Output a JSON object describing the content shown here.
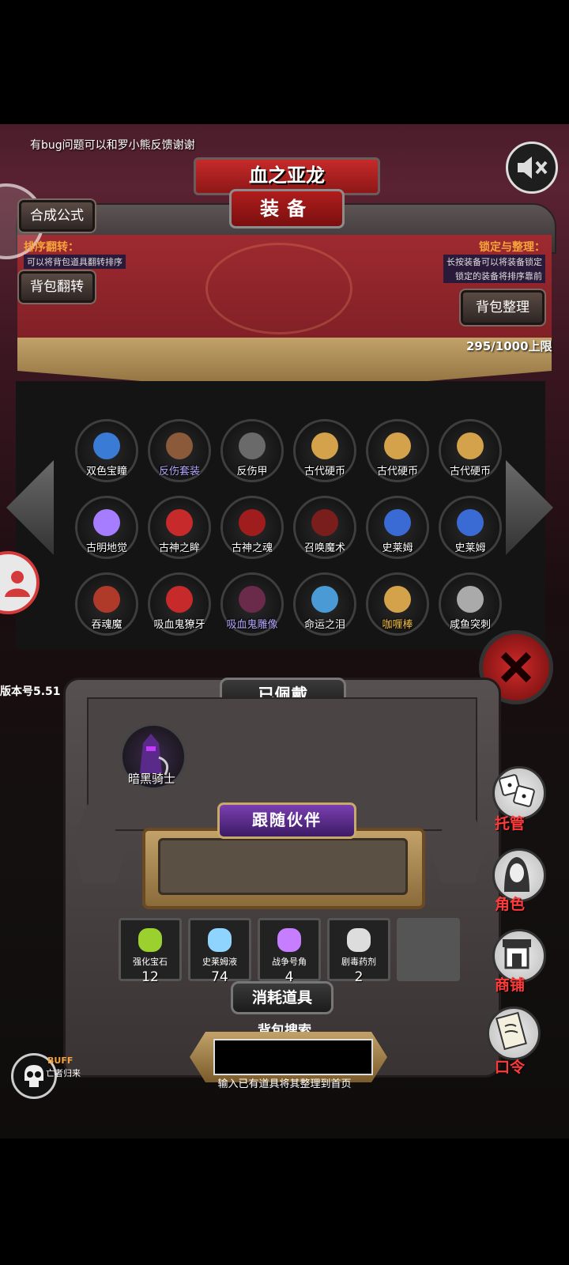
{
  "notice": "有bug问题可以和罗小熊反馈谢谢",
  "title": {
    "banner": "血之亚龙",
    "plate": "装备"
  },
  "buttons": {
    "formula": "合成公式",
    "flip": "背包翻转",
    "sort": "背包整理"
  },
  "sort_info": {
    "label": "排序翻转：",
    "desc": "可以将背包道具翻转排序"
  },
  "lock_info": {
    "label": "锁定与整理：",
    "desc1": "长按装备可以将装备锁定",
    "desc2": "锁定的装备将排序靠前"
  },
  "capacity": "295/1000上限",
  "inventory": [
    {
      "label": "双色宝瞳",
      "label_color": "#ffffff",
      "icon": "amulet-icon"
    },
    {
      "label": "反伤套装",
      "label_color": "#b7a7ff",
      "icon": "armor-set-icon"
    },
    {
      "label": "反伤甲",
      "label_color": "#ffffff",
      "icon": "armor-icon"
    },
    {
      "label": "古代硬币",
      "label_color": "#ffffff",
      "icon": "coin-icon"
    },
    {
      "label": "古代硬币",
      "label_color": "#ffffff",
      "icon": "coin-icon"
    },
    {
      "label": "古代硬币",
      "label_color": "#ffffff",
      "icon": "coin-icon"
    },
    {
      "label": "古明地觉",
      "label_color": "#ffffff",
      "icon": "girl-icon"
    },
    {
      "label": "古神之眸",
      "label_color": "#ffffff",
      "icon": "eye-icon"
    },
    {
      "label": "古神之魂",
      "label_color": "#ffffff",
      "icon": "soul-icon"
    },
    {
      "label": "召唤魔术",
      "label_color": "#ffffff",
      "icon": "pentagram-icon"
    },
    {
      "label": "史莱姆",
      "label_color": "#ffffff",
      "icon": "slime-icon"
    },
    {
      "label": "史莱姆",
      "label_color": "#ffffff",
      "icon": "slime-icon"
    },
    {
      "label": "吞魂魔",
      "label_color": "#ffffff",
      "icon": "demon-icon"
    },
    {
      "label": "吸血鬼獠牙",
      "label_color": "#ffffff",
      "icon": "fang-icon"
    },
    {
      "label": "吸血鬼雕像",
      "label_color": "#b7a7ff",
      "icon": "statue-icon"
    },
    {
      "label": "命运之泪",
      "label_color": "#ffffff",
      "icon": "tear-icon"
    },
    {
      "label": "咖喱棒",
      "label_color": "#f6c24a",
      "icon": "sword-icon"
    },
    {
      "label": "咸鱼突刺",
      "label_color": "#ffffff",
      "icon": "spear-icon"
    }
  ],
  "version": "版本号5.51",
  "equipped": {
    "header": "已佩戴",
    "item": "暗黑骑士"
  },
  "companion": {
    "header": "跟随伙伴"
  },
  "consumables": {
    "header": "消耗道具",
    "items": [
      {
        "label": "强化宝石",
        "count": "12",
        "icon": "gem-icon",
        "color": "#9bd12f"
      },
      {
        "label": "史莱姆液",
        "count": "74",
        "icon": "potion-icon",
        "color": "#8fd3ff"
      },
      {
        "label": "战争号角",
        "count": "4",
        "icon": "horn-icon",
        "color": "#c77dff"
      },
      {
        "label": "剧毒药剂",
        "count": "2",
        "icon": "poison-icon",
        "color": "#dddddd"
      }
    ]
  },
  "search": {
    "title": "背包搜索",
    "value": "",
    "hint": "输入已有道具将其整理到首页"
  },
  "side_menu": {
    "auto": "托管",
    "role": "角色",
    "shop": "商铺",
    "code": "口令"
  },
  "buff": {
    "label": "BUFF",
    "sub": "亡者归来"
  },
  "colors": {
    "accent": "#f6a33b",
    "danger": "#ff3a3a",
    "drape": "#9e2a30"
  }
}
